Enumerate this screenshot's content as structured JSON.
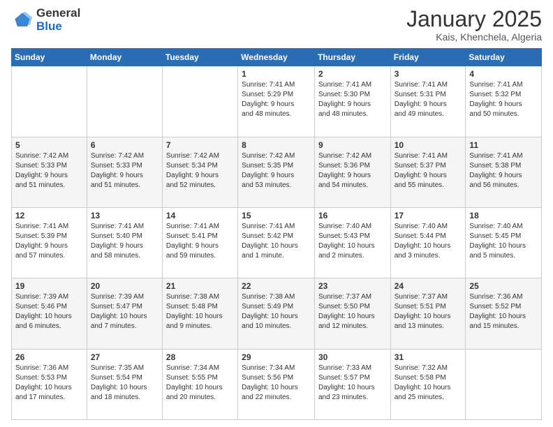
{
  "logo": {
    "general": "General",
    "blue": "Blue"
  },
  "header": {
    "month": "January 2025",
    "location": "Kais, Khenchela, Algeria"
  },
  "weekdays": [
    "Sunday",
    "Monday",
    "Tuesday",
    "Wednesday",
    "Thursday",
    "Friday",
    "Saturday"
  ],
  "weeks": [
    [
      {
        "day": "",
        "info": ""
      },
      {
        "day": "",
        "info": ""
      },
      {
        "day": "",
        "info": ""
      },
      {
        "day": "1",
        "info": "Sunrise: 7:41 AM\nSunset: 5:29 PM\nDaylight: 9 hours\nand 48 minutes."
      },
      {
        "day": "2",
        "info": "Sunrise: 7:41 AM\nSunset: 5:30 PM\nDaylight: 9 hours\nand 48 minutes."
      },
      {
        "day": "3",
        "info": "Sunrise: 7:41 AM\nSunset: 5:31 PM\nDaylight: 9 hours\nand 49 minutes."
      },
      {
        "day": "4",
        "info": "Sunrise: 7:41 AM\nSunset: 5:32 PM\nDaylight: 9 hours\nand 50 minutes."
      }
    ],
    [
      {
        "day": "5",
        "info": "Sunrise: 7:42 AM\nSunset: 5:33 PM\nDaylight: 9 hours\nand 51 minutes."
      },
      {
        "day": "6",
        "info": "Sunrise: 7:42 AM\nSunset: 5:33 PM\nDaylight: 9 hours\nand 51 minutes."
      },
      {
        "day": "7",
        "info": "Sunrise: 7:42 AM\nSunset: 5:34 PM\nDaylight: 9 hours\nand 52 minutes."
      },
      {
        "day": "8",
        "info": "Sunrise: 7:42 AM\nSunset: 5:35 PM\nDaylight: 9 hours\nand 53 minutes."
      },
      {
        "day": "9",
        "info": "Sunrise: 7:42 AM\nSunset: 5:36 PM\nDaylight: 9 hours\nand 54 minutes."
      },
      {
        "day": "10",
        "info": "Sunrise: 7:41 AM\nSunset: 5:37 PM\nDaylight: 9 hours\nand 55 minutes."
      },
      {
        "day": "11",
        "info": "Sunrise: 7:41 AM\nSunset: 5:38 PM\nDaylight: 9 hours\nand 56 minutes."
      }
    ],
    [
      {
        "day": "12",
        "info": "Sunrise: 7:41 AM\nSunset: 5:39 PM\nDaylight: 9 hours\nand 57 minutes."
      },
      {
        "day": "13",
        "info": "Sunrise: 7:41 AM\nSunset: 5:40 PM\nDaylight: 9 hours\nand 58 minutes."
      },
      {
        "day": "14",
        "info": "Sunrise: 7:41 AM\nSunset: 5:41 PM\nDaylight: 9 hours\nand 59 minutes."
      },
      {
        "day": "15",
        "info": "Sunrise: 7:41 AM\nSunset: 5:42 PM\nDaylight: 10 hours\nand 1 minute."
      },
      {
        "day": "16",
        "info": "Sunrise: 7:40 AM\nSunset: 5:43 PM\nDaylight: 10 hours\nand 2 minutes."
      },
      {
        "day": "17",
        "info": "Sunrise: 7:40 AM\nSunset: 5:44 PM\nDaylight: 10 hours\nand 3 minutes."
      },
      {
        "day": "18",
        "info": "Sunrise: 7:40 AM\nSunset: 5:45 PM\nDaylight: 10 hours\nand 5 minutes."
      }
    ],
    [
      {
        "day": "19",
        "info": "Sunrise: 7:39 AM\nSunset: 5:46 PM\nDaylight: 10 hours\nand 6 minutes."
      },
      {
        "day": "20",
        "info": "Sunrise: 7:39 AM\nSunset: 5:47 PM\nDaylight: 10 hours\nand 7 minutes."
      },
      {
        "day": "21",
        "info": "Sunrise: 7:38 AM\nSunset: 5:48 PM\nDaylight: 10 hours\nand 9 minutes."
      },
      {
        "day": "22",
        "info": "Sunrise: 7:38 AM\nSunset: 5:49 PM\nDaylight: 10 hours\nand 10 minutes."
      },
      {
        "day": "23",
        "info": "Sunrise: 7:37 AM\nSunset: 5:50 PM\nDaylight: 10 hours\nand 12 minutes."
      },
      {
        "day": "24",
        "info": "Sunrise: 7:37 AM\nSunset: 5:51 PM\nDaylight: 10 hours\nand 13 minutes."
      },
      {
        "day": "25",
        "info": "Sunrise: 7:36 AM\nSunset: 5:52 PM\nDaylight: 10 hours\nand 15 minutes."
      }
    ],
    [
      {
        "day": "26",
        "info": "Sunrise: 7:36 AM\nSunset: 5:53 PM\nDaylight: 10 hours\nand 17 minutes."
      },
      {
        "day": "27",
        "info": "Sunrise: 7:35 AM\nSunset: 5:54 PM\nDaylight: 10 hours\nand 18 minutes."
      },
      {
        "day": "28",
        "info": "Sunrise: 7:34 AM\nSunset: 5:55 PM\nDaylight: 10 hours\nand 20 minutes."
      },
      {
        "day": "29",
        "info": "Sunrise: 7:34 AM\nSunset: 5:56 PM\nDaylight: 10 hours\nand 22 minutes."
      },
      {
        "day": "30",
        "info": "Sunrise: 7:33 AM\nSunset: 5:57 PM\nDaylight: 10 hours\nand 23 minutes."
      },
      {
        "day": "31",
        "info": "Sunrise: 7:32 AM\nSunset: 5:58 PM\nDaylight: 10 hours\nand 25 minutes."
      },
      {
        "day": "",
        "info": ""
      }
    ]
  ]
}
